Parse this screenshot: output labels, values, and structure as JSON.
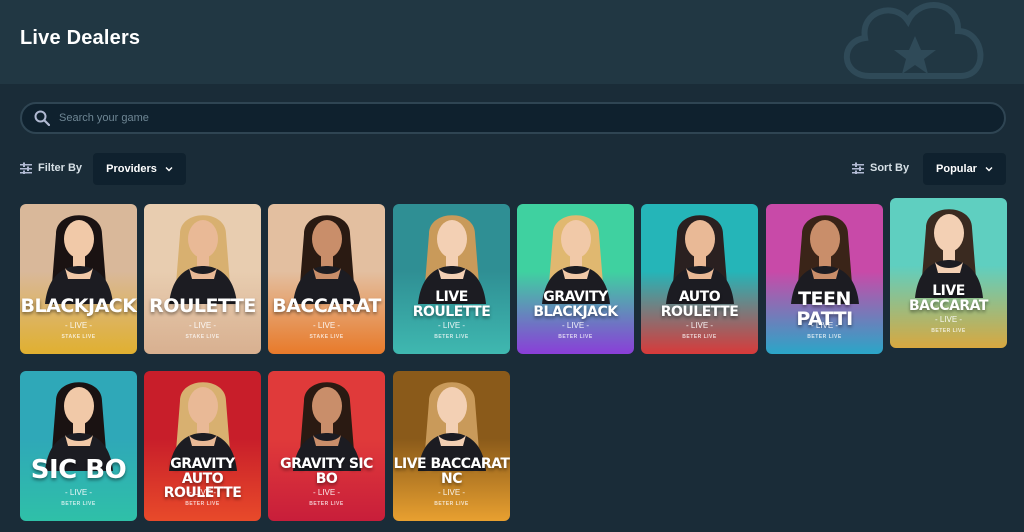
{
  "header": {
    "title": "Live Dealers"
  },
  "search": {
    "placeholder": "Search your game"
  },
  "filter": {
    "label": "Filter By",
    "providers_label": "Providers"
  },
  "sort": {
    "label": "Sort By",
    "selected": "Popular"
  },
  "games": [
    {
      "title": "BLACKJACK",
      "tag": "- LIVE -",
      "brand": "STAKE LIVE",
      "color_top": "#d9b89a",
      "color_bottom": "#e0b030"
    },
    {
      "title": "ROULETTE",
      "tag": "- LIVE -",
      "brand": "STAKE LIVE",
      "color_top": "#e8cdb0",
      "color_bottom": "#d8b090"
    },
    {
      "title": "BACCARAT",
      "tag": "- LIVE -",
      "brand": "STAKE LIVE",
      "color_top": "#e3bfa0",
      "color_bottom": "#e87a2a"
    },
    {
      "title": "LIVE ROULETTE",
      "tag": "- LIVE -",
      "brand": "BETER LIVE",
      "color_top": "#2f8f94",
      "color_bottom": "#3fb8b0"
    },
    {
      "title": "GRAVITY BLACKJACK",
      "tag": "- LIVE -",
      "brand": "BETER LIVE",
      "color_top": "#3fd1a0",
      "color_bottom": "#8a3ed8"
    },
    {
      "title": "AUTO ROULETTE",
      "tag": "- LIVE -",
      "brand": "BETER LIVE",
      "color_top": "#25b5b8",
      "color_bottom": "#d83a3a"
    },
    {
      "title": "TEEN PATTI",
      "tag": "- LIVE -",
      "brand": "BETER LIVE",
      "color_top": "#c84aa8",
      "color_bottom": "#2aa6c8"
    },
    {
      "title": "LIVE BACCARAT",
      "tag": "- LIVE -",
      "brand": "BETER LIVE",
      "color_top": "#5fcfc0",
      "color_bottom": "#d8a840"
    },
    {
      "title": "SIC BO",
      "tag": "- LIVE -",
      "brand": "BETER LIVE",
      "color_top": "#2fa8b8",
      "color_bottom": "#2fc0a8"
    },
    {
      "title": "GRAVITY AUTO ROULETTE",
      "tag": "- LIVE -",
      "brand": "BETER LIVE",
      "color_top": "#c81e2a",
      "color_bottom": "#e84a2a"
    },
    {
      "title": "GRAVITY SIC BO",
      "tag": "- LIVE -",
      "brand": "BETER LIVE",
      "color_top": "#e03a3a",
      "color_bottom": "#c81e3a"
    },
    {
      "title": "LIVE BACCARAT NC",
      "tag": "- LIVE -",
      "brand": "BETER LIVE",
      "color_top": "#8a5a1a",
      "color_bottom": "#e8a030"
    }
  ]
}
